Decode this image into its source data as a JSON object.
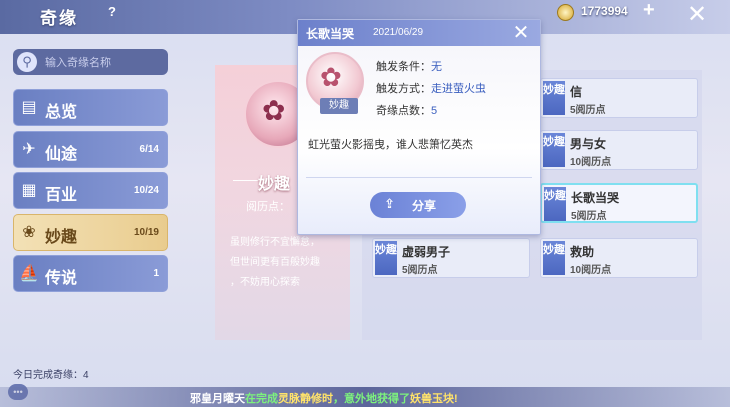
{
  "header": {
    "title": "奇缘",
    "help": "?",
    "currency": "1773994",
    "add": "+",
    "close": "✕"
  },
  "search": {
    "placeholder": "输入奇缘名称"
  },
  "sidebar": {
    "items": [
      {
        "label": "总览",
        "count": "",
        "icon": "book-icon"
      },
      {
        "label": "仙途",
        "count": "6/14",
        "icon": "bird-icon"
      },
      {
        "label": "百业",
        "count": "10/24",
        "icon": "grid-icon"
      },
      {
        "label": "妙趣",
        "count": "10/19",
        "icon": "swirl-icon"
      },
      {
        "label": "传说",
        "count": "1",
        "icon": "boat-icon"
      }
    ]
  },
  "daily": "今日完成奇缘：4",
  "chat": "•••",
  "ticker": {
    "a": "邪皇月曜天",
    "b": "在完成",
    "c": "灵脉静修时",
    "d": "，意外地获得了",
    "e": "妖兽玉块!"
  },
  "detail": {
    "category": "妙趣",
    "yueli": "阅历点：",
    "desc": [
      "虽则修行不宜懈怠，",
      "但世间更有百般妙趣",
      "，不妨用心探索"
    ]
  },
  "cards": [
    {
      "tag": "妙趣",
      "name": "信",
      "points": "5阅历点"
    },
    {
      "tag": "妙趣",
      "name": "男与女",
      "points": "10阅历点"
    },
    {
      "tag": "妙趣",
      "name": "长歌当哭",
      "points": "5阅历点"
    },
    {
      "tag": "妙趣",
      "name": "虚弱男子",
      "points": "5阅历点"
    },
    {
      "tag": "妙趣",
      "name": "救助",
      "points": "10阅历点"
    }
  ],
  "popup": {
    "name": "长歌当哭",
    "date": "2021/06/29",
    "close": "✕",
    "badge": "妙趣",
    "trigger_label": "触发条件：",
    "trigger_value": "无",
    "method_label": "触发方式：",
    "method_value": "走进萤火虫",
    "points_label": "奇缘点数：",
    "points_value": "5",
    "desc": "虹光萤火影摇曳，谁人悲箫忆英杰",
    "share": "分享"
  }
}
